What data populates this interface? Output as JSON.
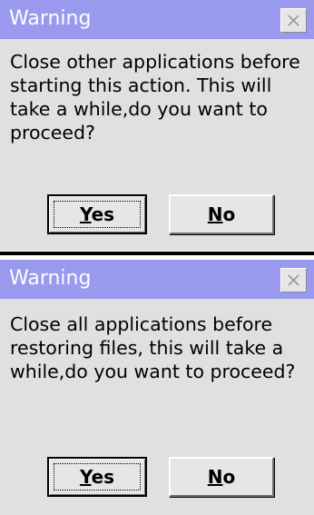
{
  "dialogs": [
    {
      "title": "Warning",
      "message": "Close other applications before starting this action. This will take a while,do you want to proceed?",
      "close_icon": "close-x",
      "buttons": [
        {
          "mnemonic": "Y",
          "rest": "es",
          "is_default": true
        },
        {
          "mnemonic": "N",
          "rest": "o",
          "is_default": false
        }
      ]
    },
    {
      "title": "Warning",
      "message": "Close all applications before restoring files, this will take a while,do you want to proceed?",
      "close_icon": "close-x",
      "buttons": [
        {
          "mnemonic": "Y",
          "rest": "es",
          "is_default": true
        },
        {
          "mnemonic": "N",
          "rest": "o",
          "is_default": false
        }
      ]
    }
  ],
  "colors": {
    "titlebar": "#9999ee",
    "title_text": "#ffffff",
    "dialog_background": "#e0e0e0",
    "button_face": "#e6e6e6"
  }
}
